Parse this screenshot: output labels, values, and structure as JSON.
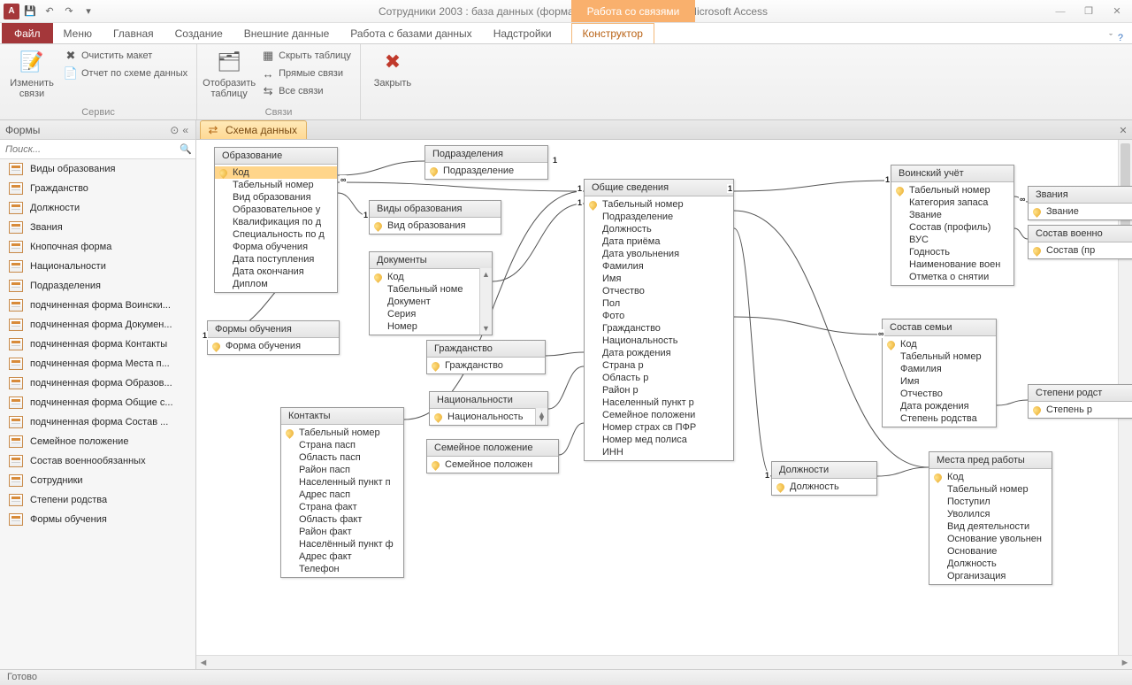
{
  "titlebar": {
    "app_letter": "A",
    "title": "Сотрудники 2003 : база данных (формат Access 2002 - 2003)  -  Microsoft Access",
    "contextual_label": "Работа со связями"
  },
  "ribbon_tabs": {
    "file": "Файл",
    "items": [
      "Меню",
      "Главная",
      "Создание",
      "Внешние данные",
      "Работа с базами данных",
      "Надстройки"
    ],
    "contextual": "Конструктор"
  },
  "ribbon": {
    "group_service": "Сервис",
    "group_links": "Связи",
    "edit_links": "Изменить связи",
    "clear_layout": "Очистить макет",
    "report": "Отчет по схеме данных",
    "show_table": "Отобразить таблицу",
    "hide_table": "Скрыть таблицу",
    "direct_links": "Прямые связи",
    "all_links": "Все связи",
    "close": "Закрыть"
  },
  "nav": {
    "header": "Формы",
    "search_placeholder": "Поиск...",
    "items": [
      "Виды образования",
      "Гражданство",
      "Должности",
      "Звания",
      "Кнопочная форма",
      "Национальности",
      "Подразделения",
      "подчиненная форма Воински...",
      "подчиненная форма Докумен...",
      "подчиненная форма Контакты",
      "подчиненная форма Места п...",
      "подчиненная форма Образов...",
      "подчиненная форма Общие с...",
      "подчиненная форма Состав ...",
      "Семейное положение",
      "Состав военнообязанных",
      "Сотрудники",
      "Степени родства",
      "Формы обучения"
    ]
  },
  "doc_tab": "Схема данных",
  "tables": {
    "obrazovanie": {
      "title": "Образование",
      "fields": [
        {
          "n": "Код",
          "pk": true,
          "sel": true
        },
        {
          "n": "Табельный номер"
        },
        {
          "n": "Вид образования"
        },
        {
          "n": "Образовательное у"
        },
        {
          "n": "Квалификация по д"
        },
        {
          "n": "Специальность по д"
        },
        {
          "n": "Форма обучения"
        },
        {
          "n": "Дата поступления"
        },
        {
          "n": "Дата окончания"
        },
        {
          "n": "Диплом"
        }
      ]
    },
    "formy_obucheniya": {
      "title": "Формы обучения",
      "fields": [
        {
          "n": "Форма обучения",
          "pk": true
        }
      ]
    },
    "vidy_obrazovaniya": {
      "title": "Виды образования",
      "fields": [
        {
          "n": "Вид образования",
          "pk": true
        }
      ]
    },
    "dokumenty": {
      "title": "Документы",
      "fields": [
        {
          "n": "Код",
          "pk": true
        },
        {
          "n": "Табельный номе"
        },
        {
          "n": "Документ"
        },
        {
          "n": "Серия"
        },
        {
          "n": "Номер"
        }
      ],
      "scroll": true
    },
    "podrazdeleniya": {
      "title": "Подразделения",
      "fields": [
        {
          "n": "Подразделение",
          "pk": true
        }
      ]
    },
    "grazhdanstvo": {
      "title": "Гражданство",
      "fields": [
        {
          "n": "Гражданство",
          "pk": true
        }
      ]
    },
    "natsionalnosti": {
      "title": "Национальности",
      "fields": [
        {
          "n": "Национальность",
          "pk": true
        }
      ],
      "scroll": true
    },
    "semeinoe": {
      "title": "Семейное положение",
      "fields": [
        {
          "n": "Семейное положен",
          "pk": true
        }
      ]
    },
    "kontakty": {
      "title": "Контакты",
      "fields": [
        {
          "n": "Табельный номер",
          "pk": true
        },
        {
          "n": "Страна пасп"
        },
        {
          "n": "Область пасп"
        },
        {
          "n": "Район пасп"
        },
        {
          "n": "Населенный пункт п"
        },
        {
          "n": "Адрес пасп"
        },
        {
          "n": "Страна факт"
        },
        {
          "n": "Область факт"
        },
        {
          "n": "Район факт"
        },
        {
          "n": "Населённый пункт ф"
        },
        {
          "n": "Адрес факт"
        },
        {
          "n": "Телефон"
        }
      ]
    },
    "obshchie": {
      "title": "Общие сведения",
      "fields": [
        {
          "n": "Табельный номер",
          "pk": true
        },
        {
          "n": "Подразделение"
        },
        {
          "n": "Должность"
        },
        {
          "n": "Дата приёма"
        },
        {
          "n": "Дата увольнения"
        },
        {
          "n": "Фамилия"
        },
        {
          "n": "Имя"
        },
        {
          "n": "Отчество"
        },
        {
          "n": "Пол"
        },
        {
          "n": "Фото"
        },
        {
          "n": "Гражданство"
        },
        {
          "n": "Национальность"
        },
        {
          "n": "Дата рождения"
        },
        {
          "n": "Страна р"
        },
        {
          "n": "Область р"
        },
        {
          "n": "Район р"
        },
        {
          "n": "Населенный пункт р"
        },
        {
          "n": "Семейное положени"
        },
        {
          "n": "Номер страх св ПФР"
        },
        {
          "n": "Номер мед полиса"
        },
        {
          "n": "ИНН"
        }
      ]
    },
    "dolzhnosti": {
      "title": "Должности",
      "fields": [
        {
          "n": "Должность",
          "pk": true
        }
      ]
    },
    "voinskiy": {
      "title": "Воинский учёт",
      "fields": [
        {
          "n": "Табельный номер",
          "pk": true
        },
        {
          "n": "Категория запаса"
        },
        {
          "n": "Звание"
        },
        {
          "n": "Состав (профиль)"
        },
        {
          "n": "ВУС"
        },
        {
          "n": "Годность"
        },
        {
          "n": "Наименование воен"
        },
        {
          "n": "Отметка о снятии"
        }
      ]
    },
    "zvaniya": {
      "title": "Звания",
      "fields": [
        {
          "n": "Звание",
          "pk": true
        }
      ]
    },
    "sostav_voen": {
      "title": "Состав военно",
      "fields": [
        {
          "n": "Состав (пр",
          "pk": true
        }
      ]
    },
    "sostav_semi": {
      "title": "Состав семьи",
      "fields": [
        {
          "n": "Код",
          "pk": true
        },
        {
          "n": "Табельный номер"
        },
        {
          "n": "Фамилия"
        },
        {
          "n": "Имя"
        },
        {
          "n": "Отчество"
        },
        {
          "n": "Дата рождения"
        },
        {
          "n": "Степень родства"
        }
      ]
    },
    "stepeni": {
      "title": "Степени родст",
      "fields": [
        {
          "n": "Степень р",
          "pk": true
        }
      ]
    },
    "mesta": {
      "title": "Места пред работы",
      "fields": [
        {
          "n": "Код",
          "pk": true
        },
        {
          "n": "Табельный номер"
        },
        {
          "n": "Поступил"
        },
        {
          "n": "Уволился"
        },
        {
          "n": "Вид деятельности"
        },
        {
          "n": "Основание увольнен"
        },
        {
          "n": "Основание"
        },
        {
          "n": "Должность"
        },
        {
          "n": "Организация"
        }
      ]
    }
  },
  "status": "Готово"
}
